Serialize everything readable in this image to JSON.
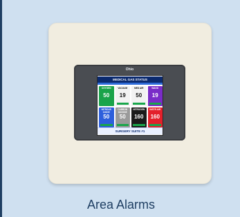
{
  "caption": "Area Alarms",
  "device": {
    "brand": "Ohio",
    "screen_title": "MEDICAL GAS STATUS",
    "location": "SURGERY SUITE #1",
    "tiles": [
      {
        "label": "OXYGEN",
        "value": "50",
        "color": "#1aa34a"
      },
      {
        "label": "VACUUM",
        "value": "19",
        "color": "#f2f2f2"
      },
      {
        "label": "MED AIR",
        "value": "50",
        "color": "#f2f2f2"
      },
      {
        "label": "WAGD",
        "value": "19",
        "color": "#7a2cc8"
      },
      {
        "label": "NITROUS OXIDE",
        "value": "50",
        "color": "#2d5fdc"
      },
      {
        "label": "CARBON DIOXIDE",
        "value": "50",
        "color": "#9a9a9a"
      },
      {
        "label": "NITROGEN",
        "value": "160",
        "color": "#1a1a1a"
      },
      {
        "label": "INSTR AIR",
        "value": "160",
        "color": "#e3202b"
      }
    ]
  }
}
